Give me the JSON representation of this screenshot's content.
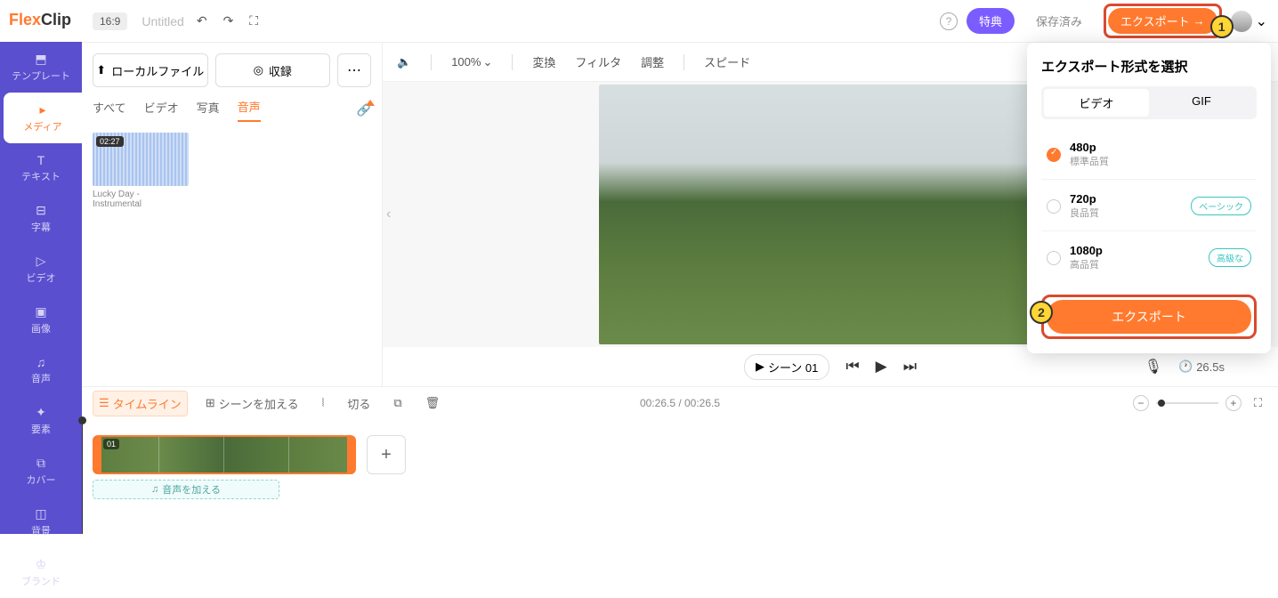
{
  "logo": {
    "brand1": "Flex",
    "brand2": "Clip"
  },
  "nav": [
    {
      "icon": "⬚",
      "label": "テンプレート"
    },
    {
      "icon": "▸",
      "label": "メディア"
    },
    {
      "icon": "T",
      "label": "テキスト"
    },
    {
      "icon": "⊟",
      "label": "字幕"
    },
    {
      "icon": "▷",
      "label": "ビデオ"
    },
    {
      "icon": "▣",
      "label": "画像"
    },
    {
      "icon": "♫",
      "label": "音声"
    },
    {
      "icon": "✦",
      "label": "要素"
    },
    {
      "icon": "⧉",
      "label": "カバー"
    },
    {
      "icon": "◫",
      "label": "背景"
    },
    {
      "icon": "♔",
      "label": "ブランド"
    }
  ],
  "topbar": {
    "ratio": "16:9",
    "title": "Untitled",
    "help": "?",
    "promo": "特典",
    "saved": "保存済み",
    "export": "エクスポート",
    "export_arrow": "→"
  },
  "media": {
    "local_file": "ローカルファイル",
    "record": "収録",
    "tabs": [
      "すべて",
      "ビデオ",
      "写真",
      "音声"
    ],
    "audio": {
      "dur": "02:27",
      "name": "Lucky Day - Instrumental"
    }
  },
  "preview": {
    "volume_icon": "🔈",
    "zoom": "100%",
    "menus": [
      "変換",
      "フィルタ",
      "調整",
      "スピード"
    ],
    "scene": "シーン 01",
    "duration": "26.5s"
  },
  "export_popup": {
    "title": "エクスポート形式を選択",
    "fmt_tabs": [
      "ビデオ",
      "GIF"
    ],
    "options": [
      {
        "res": "480p",
        "desc": "標準品質",
        "badge": ""
      },
      {
        "res": "720p",
        "desc": "良品質",
        "badge": "ベーシック"
      },
      {
        "res": "1080p",
        "desc": "高品質",
        "badge": "高級な"
      }
    ],
    "action": "エクスポート"
  },
  "annotations": {
    "one": "1",
    "two": "2"
  },
  "timeline": {
    "timeline_btn": "タイムライン",
    "add_scene": "シーンを加える",
    "cut": "切る",
    "time": "00:26.5 / 00:26.5",
    "clip_label": "01",
    "add_audio": "音声を加える"
  }
}
